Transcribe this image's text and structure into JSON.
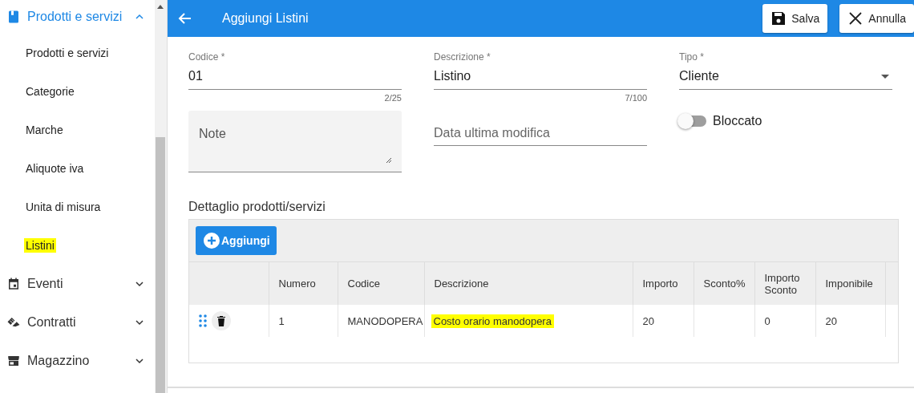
{
  "sidebar": {
    "groups": [
      {
        "label": "Prodotti e servizi",
        "kind": "book",
        "active": true,
        "expanded": true,
        "children": [
          {
            "label": "Prodotti e servizi",
            "highlighted": false
          },
          {
            "label": "Categorie",
            "highlighted": false
          },
          {
            "label": "Marche",
            "highlighted": false
          },
          {
            "label": "Aliquote iva",
            "highlighted": false
          },
          {
            "label": "Unita di misura",
            "highlighted": false
          },
          {
            "label": "Listini",
            "highlighted": true
          }
        ]
      },
      {
        "label": "Eventi",
        "kind": "calendar",
        "active": false,
        "expanded": false
      },
      {
        "label": "Contratti",
        "kind": "handshake",
        "active": false,
        "expanded": false
      },
      {
        "label": "Magazzino",
        "kind": "store",
        "active": false,
        "expanded": false
      }
    ]
  },
  "header": {
    "title": "Aggiungi Listini",
    "buttons": [
      {
        "label": "Salva",
        "kind": "save"
      },
      {
        "label": "Annulla",
        "kind": "cancel"
      }
    ]
  },
  "form": {
    "codice": {
      "label": "Codice *",
      "value": "01",
      "counter": "2/25"
    },
    "descrizione": {
      "label": "Descrizione *",
      "value": "Listino",
      "counter": "7/100"
    },
    "tipo": {
      "label": "Tipo *",
      "value": "Cliente"
    },
    "note": {
      "placeholder": "Note"
    },
    "data": {
      "placeholder": "Data ultima modifica"
    },
    "bloccato": {
      "label": "Bloccato",
      "on": false
    }
  },
  "detail": {
    "title": "Dettaglio prodotti/servizi",
    "add_button": "Aggiungi",
    "table": {
      "columns": [
        "Numero",
        "Codice",
        "Descrizione",
        "Importo",
        "Sconto%",
        "Importo Sconto",
        "Imponibile"
      ],
      "rows": [
        {
          "numero": "1",
          "codice": "MANODOPERA",
          "descrizione": "Costo orario manodopera",
          "descrizione_highlighted": true,
          "importo": "20",
          "importo_sconto": "0",
          "imponibile": "20"
        }
      ]
    }
  }
}
